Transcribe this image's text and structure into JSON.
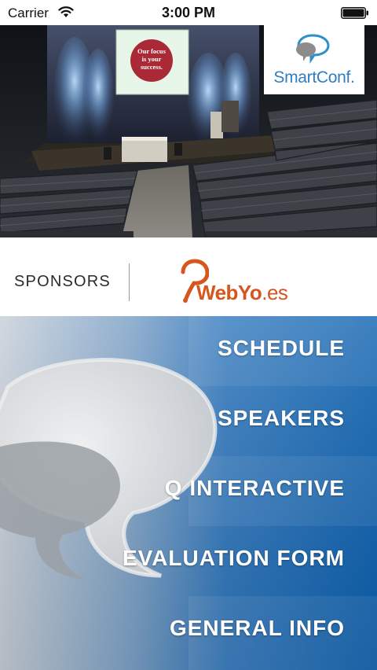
{
  "status_bar": {
    "carrier": "Carrier",
    "time": "3:00 PM"
  },
  "hero": {
    "screen_text_line1": "Our focus",
    "screen_text_line2": "is your",
    "screen_text_line3": "success."
  },
  "app_logo": {
    "text": "SmartConf.",
    "color": "#2f7ec1"
  },
  "sponsors": {
    "label": "SPONSORS",
    "sponsor_name": "WebYo",
    "sponsor_tld": ".es",
    "sponsor_color": "#d6561d"
  },
  "menu": {
    "items": [
      {
        "label": "SCHEDULE"
      },
      {
        "label": "SPEAKERS"
      },
      {
        "label": "Q INTERACTIVE"
      },
      {
        "label": "EVALUATION FORM"
      },
      {
        "label": "GENERAL INFO"
      }
    ],
    "accent_color": "#0d65b5"
  }
}
